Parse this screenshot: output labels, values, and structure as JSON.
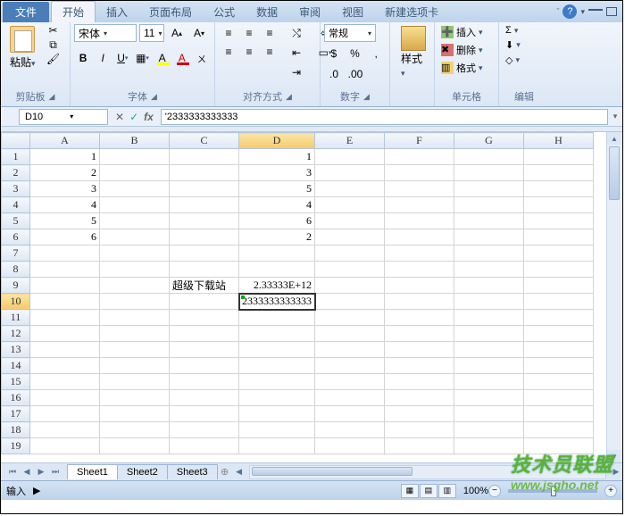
{
  "tabs": {
    "file": "文件",
    "home": "开始",
    "insert": "插入",
    "layout": "页面布局",
    "formulas": "公式",
    "data": "数据",
    "review": "审阅",
    "view": "视图",
    "newtab": "新建选项卡"
  },
  "ribbon": {
    "clipboard": {
      "label": "剪贴板",
      "paste": "粘贴"
    },
    "font": {
      "label": "字体",
      "name": "宋体",
      "size": "11"
    },
    "alignment": {
      "label": "对齐方式"
    },
    "number": {
      "label": "数字",
      "format": "常规"
    },
    "styles": {
      "label": "样式",
      "btn": "样式"
    },
    "cells": {
      "label": "单元格",
      "insert": "插入",
      "delete": "删除",
      "format": "格式"
    },
    "editing": {
      "label": "编辑"
    }
  },
  "formula_bar": {
    "cell_ref": "D10",
    "cancel": "✕",
    "enter": "✓",
    "fx": "fx",
    "value": "'2333333333333"
  },
  "columns": [
    "A",
    "B",
    "C",
    "D",
    "E",
    "F",
    "G",
    "H"
  ],
  "rows": [
    {
      "n": 1,
      "cells": {
        "A": "1",
        "D": "1"
      }
    },
    {
      "n": 2,
      "cells": {
        "A": "2",
        "D": "3"
      }
    },
    {
      "n": 3,
      "cells": {
        "A": "3",
        "D": "5"
      }
    },
    {
      "n": 4,
      "cells": {
        "A": "4",
        "D": "4"
      }
    },
    {
      "n": 5,
      "cells": {
        "A": "5",
        "D": "6"
      }
    },
    {
      "n": 6,
      "cells": {
        "A": "6",
        "D": "2"
      }
    },
    {
      "n": 7,
      "cells": {}
    },
    {
      "n": 8,
      "cells": {}
    },
    {
      "n": 9,
      "cells": {
        "C": "超级下载站",
        "D": "2.33333E+12"
      }
    },
    {
      "n": 10,
      "cells": {
        "D": "2333333333333"
      },
      "selected": true,
      "tick": true
    },
    {
      "n": 11,
      "cells": {}
    },
    {
      "n": 12,
      "cells": {}
    },
    {
      "n": 13,
      "cells": {}
    },
    {
      "n": 14,
      "cells": {}
    },
    {
      "n": 15,
      "cells": {}
    },
    {
      "n": 16,
      "cells": {}
    },
    {
      "n": 17,
      "cells": {}
    },
    {
      "n": 18,
      "cells": {}
    },
    {
      "n": 19,
      "cells": {}
    }
  ],
  "sheets": {
    "s1": "Sheet1",
    "s2": "Sheet2",
    "s3": "Sheet3"
  },
  "status": {
    "mode": "输入",
    "zoom": "100%"
  },
  "watermark": {
    "cn": "技术员联盟",
    "url": "www.jsgho.net"
  }
}
